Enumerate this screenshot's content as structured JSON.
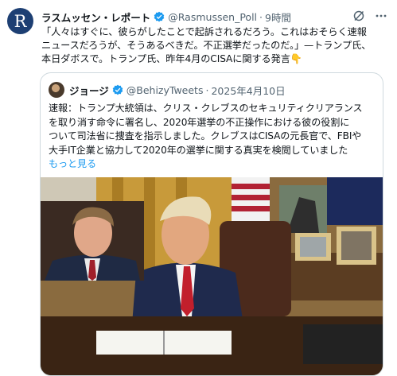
{
  "tweet": {
    "author_name": "ラスムッセン・レポート",
    "author_handle": "@Rasmussen_Poll",
    "separator": "·",
    "time": "9時間",
    "avatar_letter": "R",
    "text_lines": [
      "「人々はすぐに、彼らがしたことで起訴されるだろう。これはおそらく速報",
      "ニュースだろうが、そうあるべきだ。不正選挙だったのだ。」—トランプ氏、",
      "本日ダボスで。トランプ氏、昨年4月のCISAに関する発言👇"
    ]
  },
  "quoted": {
    "author_name": "ジョージ",
    "author_handle": "@BehizyTweets",
    "separator": "·",
    "date": "2025年4月10日",
    "text_lines": [
      "速報：トランプ大統領は、クリス・クレブスのセキュリティクリアランス",
      "を取り消す命令に署名し、2020年選挙の不正操作における彼の役割に",
      "ついて司法省に捜査を指示しました。クレブスはCISAの元長官で、FBIや",
      "大手IT企業と協力して2020年の選挙に関する真実を検閲していました"
    ],
    "show_more": "もっと見る"
  },
  "colors": {
    "accent": "#1d9bf0",
    "muted": "#536471",
    "border": "#cfd9de",
    "avatar_bg": "#1d3f73"
  },
  "icons": [
    "verified-badge-icon",
    "grok-icon",
    "more-options-icon"
  ]
}
